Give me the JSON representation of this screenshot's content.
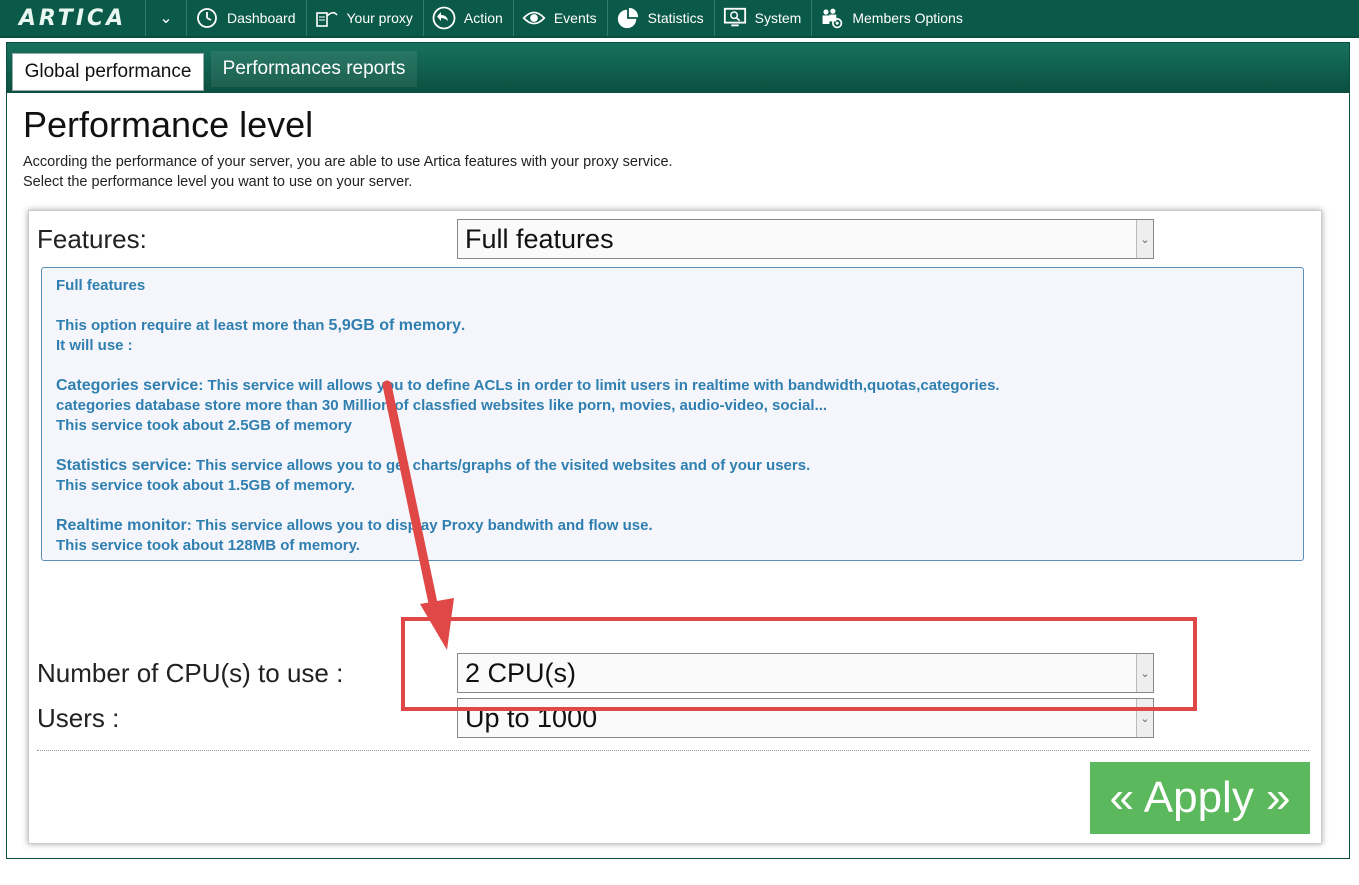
{
  "nav": {
    "logo": "ARTICA",
    "items": [
      {
        "label": "Dashboard",
        "icon": "dashboard-icon"
      },
      {
        "label": "Your proxy",
        "icon": "proxy-icon"
      },
      {
        "label": "Action",
        "icon": "back-arrow-icon"
      },
      {
        "label": "Events",
        "icon": "eye-icon"
      },
      {
        "label": "Statistics",
        "icon": "pie-chart-icon"
      },
      {
        "label": "System",
        "icon": "monitor-icon"
      },
      {
        "label": "Members Options",
        "icon": "members-icon"
      }
    ]
  },
  "tabs": {
    "active": "Global performance",
    "other": "Performances reports"
  },
  "page": {
    "title": "Performance level",
    "desc1": "According the performance of your server, you are able to use Artica features with your proxy service.",
    "desc2": "Select the performance level you want to use on your server."
  },
  "form": {
    "features_label": "Features:",
    "features_value": "Full features",
    "cpu_label": "Number of CPU(s) to use :",
    "cpu_value": "2 CPU(s)",
    "users_label": "Users :",
    "users_value": "Up to 1000",
    "apply_label": "« Apply »"
  },
  "info": {
    "title": "Full features",
    "req_prefix": "This option require at least more than ",
    "req_value": "5,9GB of memory",
    "req_suffix": ".",
    "will_use": "It will use :",
    "cat_title": "Categories service",
    "cat_text": ": This service will allows you to define ACLs in order to limit users in realtime with bandwidth,quotas,categories.",
    "cat_line2": "categories database store more than 30 Million of classfied websites like porn, movies, audio-video, social...",
    "cat_line3": "This service took about 2.5GB of memory",
    "stat_title": "Statistics service",
    "stat_text": ": This service allows you to get charts/graphs of the visited websites and of your users.",
    "stat_line2": "This service took about 1.5GB of memory.",
    "rt_title": "Realtime monitor",
    "rt_text": ": This service allows you to display Proxy bandwith and flow use.",
    "rt_line2": "This service took about 128MB of memory."
  },
  "colors": {
    "nav_bg": "#0b5a49",
    "info_text": "#2f7fb0",
    "apply_bg": "#5cb85c",
    "annotation": "#e04848"
  }
}
